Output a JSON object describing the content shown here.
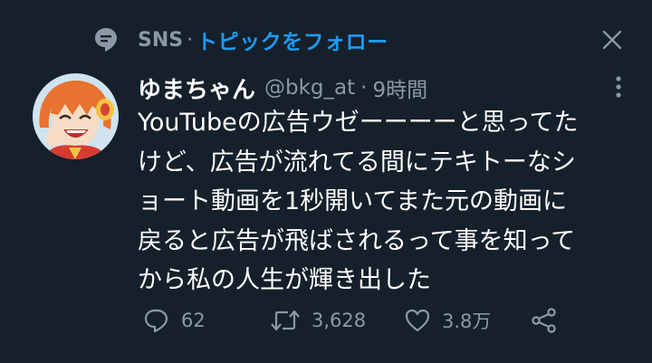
{
  "topic": {
    "name": "SNS",
    "separator": "·",
    "follow_label": "トピックをフォロー",
    "icon": "topic-bubble-icon",
    "close_icon": "close-icon"
  },
  "tweet": {
    "avatar": "avatar",
    "display_name": "ゆまちゃん",
    "handle": "@bkg_at",
    "separator": "·",
    "time": "9時間",
    "text": "YouTubeの広告ウゼーーーーと思ってた\nけど、広告が流れてる間にテキトーなシ\nョート動画を1秒開いてまた元の動画に\n戻ると広告が飛ばされるって事を知って\nから私の人生が輝き出した",
    "more_icon": "more-vertical-icon"
  },
  "actions": {
    "reply": {
      "icon": "reply-icon",
      "count": "62"
    },
    "retweet": {
      "icon": "retweet-icon",
      "count": "3,628"
    },
    "like": {
      "icon": "heart-icon",
      "count": "3.8万"
    },
    "share": {
      "icon": "share-icon"
    }
  },
  "colors": {
    "background": "#15202b",
    "text": "#ffffff",
    "secondary": "#8b98a5",
    "accent": "#1d9bf0"
  }
}
